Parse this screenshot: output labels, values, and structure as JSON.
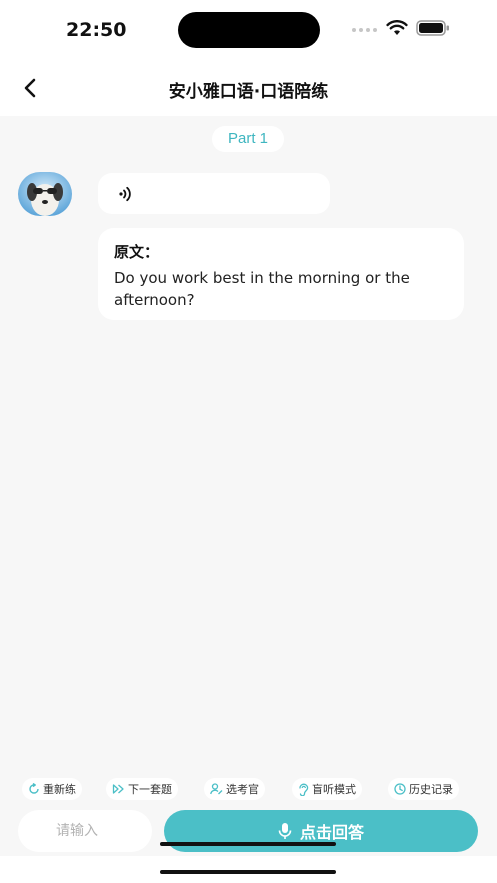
{
  "status_bar": {
    "time": "22:50"
  },
  "nav": {
    "title": "安小雅口语·口语陪练"
  },
  "chat": {
    "part_label": "Part 1",
    "audio_icon": "speaker-icon",
    "original_label": "原文：",
    "original_text": "Do you work best in the morning or the afternoon?"
  },
  "toolbar": {
    "items": [
      {
        "label": "重新练",
        "icon": "refresh-icon"
      },
      {
        "label": "下一套题",
        "icon": "play-next-icon"
      },
      {
        "label": "选考官",
        "icon": "user-edit-icon"
      },
      {
        "label": "盲听模式",
        "icon": "ear-icon"
      },
      {
        "label": "历史记录",
        "icon": "clock-icon"
      }
    ]
  },
  "input": {
    "placeholder": "请输入",
    "answer_button_label": "点击回答",
    "answer_icon": "microphone-icon"
  },
  "colors": {
    "accent": "#4bbfc7",
    "part_badge_text": "#3fb6c0",
    "background": "#f7f7f7"
  }
}
